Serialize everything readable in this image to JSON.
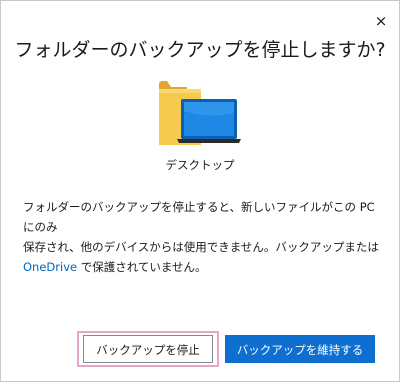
{
  "dialog": {
    "close_glyph": "×",
    "title": "フォルダーのバックアップを停止しますか?",
    "folder_label": "デスクトップ",
    "message": {
      "line1": "フォルダーのバックアップを停止すると、新しいファイルがこの PC にのみ",
      "line2": "保存され、他のデバイスからは使用できません。バックアップまたは",
      "line3_accent": "OneDrive",
      "line3_rest": " で保護されていません。"
    }
  },
  "buttons": {
    "stop_label": "バックアップを停止",
    "keep_label": "バックアップを維持する"
  },
  "colors": {
    "accent": "#0f6fd1",
    "link": "#0067b8",
    "highlight_outline": "#e8a6cb",
    "folder": "#f6c94f",
    "laptop_screen": "#1e88e5"
  }
}
